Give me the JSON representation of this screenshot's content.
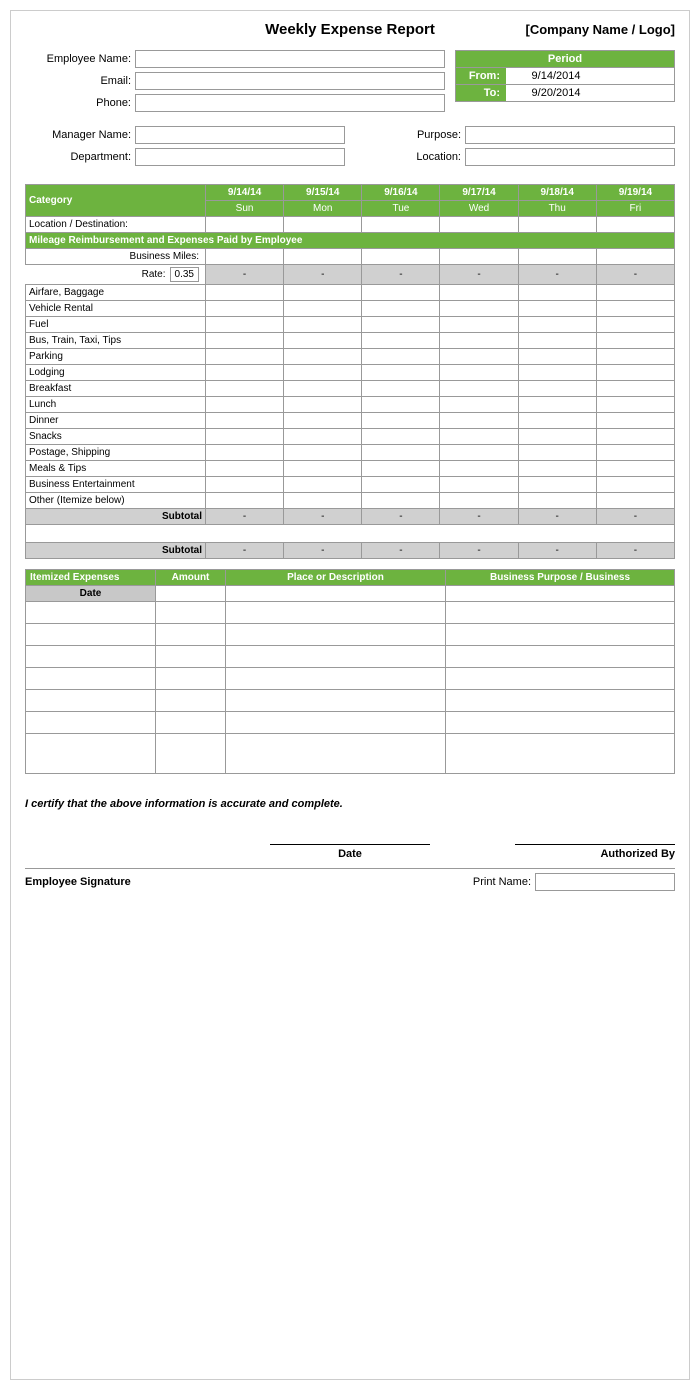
{
  "header": {
    "title": "Weekly Expense Report",
    "company": "[Company Name / Logo]"
  },
  "employee_form": {
    "name_label": "Employee Name:",
    "email_label": "Email:",
    "phone_label": "Phone:",
    "manager_label": "Manager Name:",
    "department_label": "Department:",
    "purpose_label": "Purpose:",
    "location_label": "Location:"
  },
  "period": {
    "title": "Period",
    "from_label": "From:",
    "from_value": "9/14/2014",
    "to_label": "To:",
    "to_value": "9/20/2014"
  },
  "table": {
    "category_header": "Category",
    "dates": [
      "9/14/14",
      "9/15/14",
      "9/16/14",
      "9/17/14",
      "9/18/14",
      "9/19/14"
    ],
    "days": [
      "Sun",
      "Mon",
      "Tue",
      "Wed",
      "Thu",
      "Fri"
    ],
    "location_row": "Location / Destination:",
    "mileage_section": "Mileage Reimbursement and Expenses Paid by Employee",
    "business_miles_label": "Business Miles:",
    "rate_label": "Rate:",
    "rate_value": "0.35",
    "expense_categories": [
      "Airfare, Baggage",
      "Vehicle Rental",
      "Fuel",
      "Bus, Train, Taxi, Tips",
      "Parking",
      "Lodging",
      "Breakfast",
      "Lunch",
      "Dinner",
      "Snacks",
      "Postage, Shipping",
      "Meals & Tips",
      "Business Entertainment",
      "Other (Itemize below)"
    ],
    "subtotal_label": "Subtotal",
    "dash": "-"
  },
  "itemized": {
    "header": "Itemized Expenses",
    "amount_col": "Amount",
    "place_col": "Place or Description",
    "purpose_col": "Business Purpose / Business",
    "date_col": "Date",
    "rows": 7
  },
  "certification": {
    "text": "I certify that the above information is accurate and complete."
  },
  "signature": {
    "date_label": "Date",
    "authorized_label": "Authorized By",
    "employee_sig_label": "Employee Signature",
    "print_name_label": "Print Name:"
  }
}
